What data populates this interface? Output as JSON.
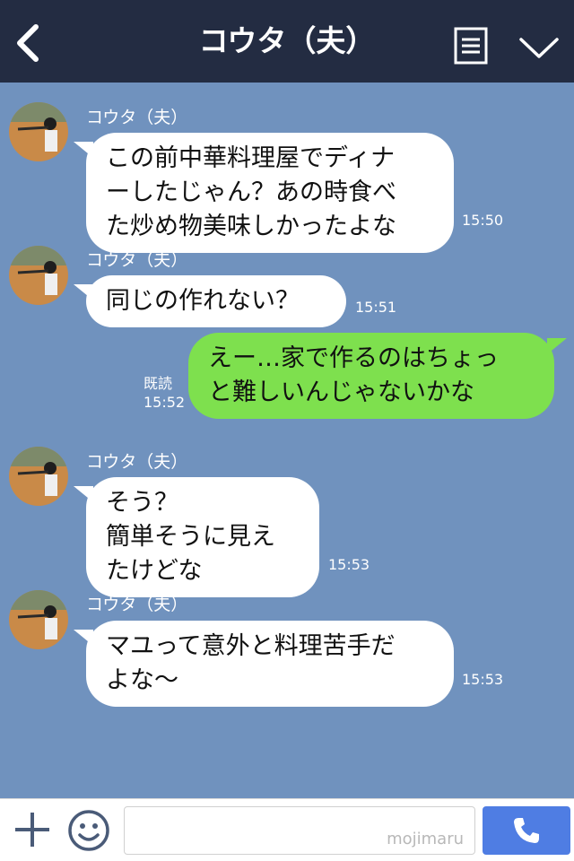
{
  "header": {
    "title": "コウタ（夫）",
    "back_icon": "back-arrow-icon",
    "menu_icon": "list-menu-icon",
    "expand_icon": "chevron-down-icon"
  },
  "messages": [
    {
      "sender": "コウタ（夫）",
      "text": "この前中華料理屋でディナ\nーしたじゃん？あの時食べ\nた炒め物美味しかったよな",
      "time": "15:50"
    },
    {
      "sender": "コウタ（夫）",
      "text": "同じの作れない？",
      "time": "15:51"
    },
    {
      "text": "えー…家で作るのはちょっ\nと難しいんじゃないかな",
      "read": "既読",
      "time": "15:52"
    },
    {
      "sender": "コウタ（夫）",
      "text": "そう？\n簡単そうに見え\nたけどな",
      "time": "15:53"
    },
    {
      "sender": "コウタ（夫）",
      "text": "マユって意外と料理苦手だ\nよな〜",
      "time": "15:53"
    }
  ],
  "input_bar": {
    "plus_icon": "plus-icon",
    "emoji_icon": "smiley-icon",
    "input_value": "",
    "watermark": "mojimaru",
    "call_icon": "phone-icon"
  },
  "colors": {
    "header_bg": "#232c42",
    "chat_bg": "#7092be",
    "incoming_bubble": "#ffffff",
    "outgoing_bubble": "#7ee04e",
    "call_button": "#4f7de3"
  }
}
